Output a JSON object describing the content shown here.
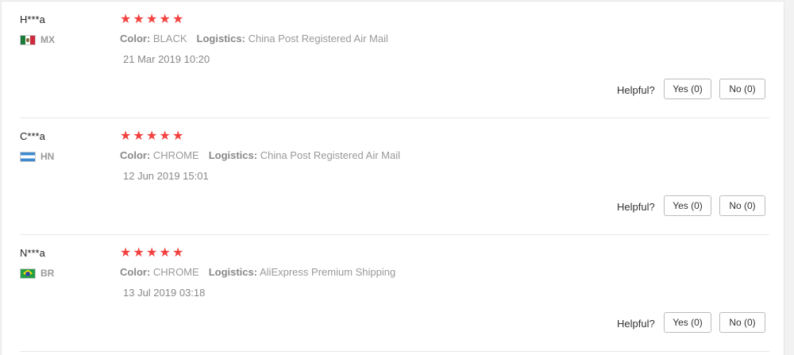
{
  "reviews": [
    {
      "user": "H***a",
      "country": "MX",
      "flag": "mexico-flag",
      "stars": 5,
      "color_label": "Color:",
      "color_value": "BLACK",
      "logistics_label": "Logistics:",
      "logistics_value": "China Post Registered Air Mail",
      "date": "21 Mar 2019 10:20",
      "helpful_label": "Helpful?",
      "yes_label": "Yes (0)",
      "no_label": "No (0)"
    },
    {
      "user": "C***a",
      "country": "HN",
      "flag": "honduras-flag",
      "stars": 5,
      "color_label": "Color:",
      "color_value": "CHROME",
      "logistics_label": "Logistics:",
      "logistics_value": "China Post Registered Air Mail",
      "date": "12 Jun 2019 15:01",
      "helpful_label": "Helpful?",
      "yes_label": "Yes (0)",
      "no_label": "No (0)"
    },
    {
      "user": "N***a",
      "country": "BR",
      "flag": "brazil-flag",
      "stars": 5,
      "color_label": "Color:",
      "color_value": "CHROME",
      "logistics_label": "Logistics:",
      "logistics_value": "AliExpress Premium Shipping",
      "date": "13 Jul 2019 03:18",
      "helpful_label": "Helpful?",
      "yes_label": "Yes (0)",
      "no_label": "No (0)"
    }
  ],
  "colors": {
    "star": "#f2413f",
    "muted_text": "#999999",
    "divider": "#e8e8e8"
  }
}
